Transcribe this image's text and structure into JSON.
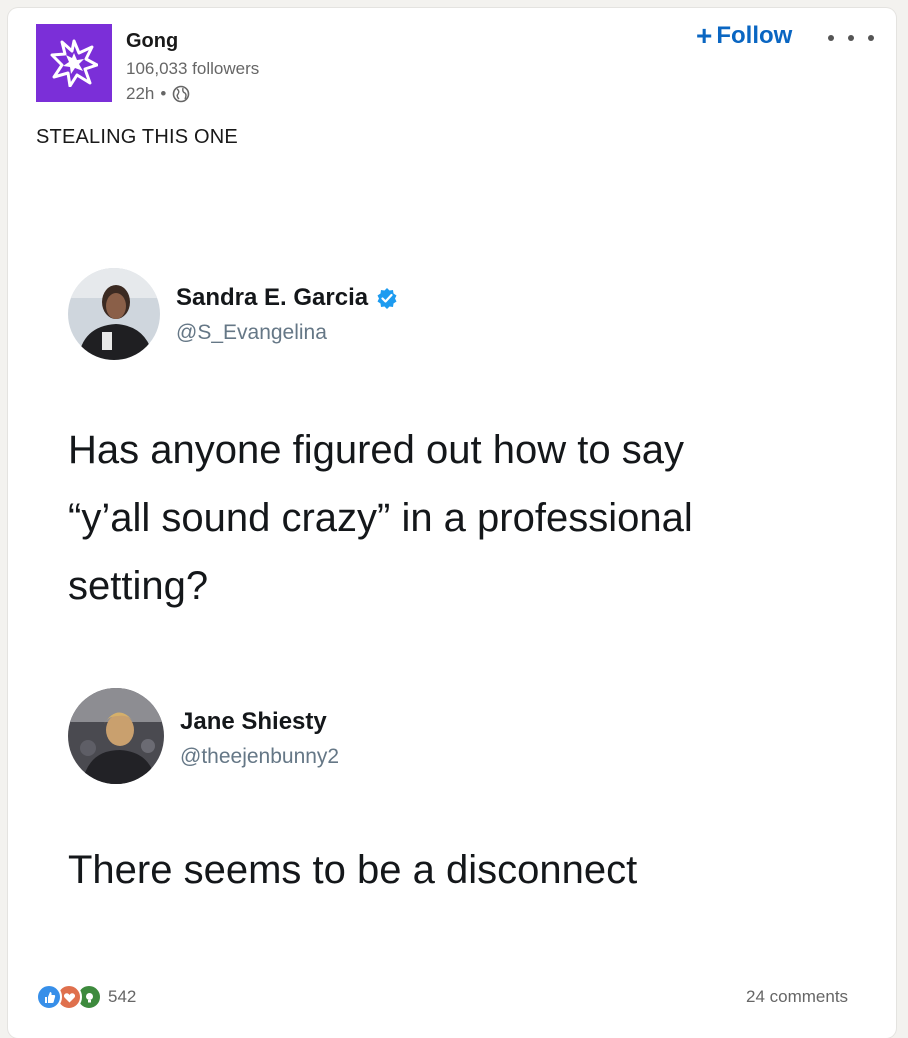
{
  "post": {
    "author": {
      "name": "Gong",
      "followers": "106,033 followers",
      "time": "22h",
      "separator": "•",
      "visibility_icon": "globe-icon",
      "logo_color": "#7b2fd8"
    },
    "follow_label": "Follow",
    "follow_plus": "+",
    "caption": "STEALING THIS ONE"
  },
  "tweets": [
    {
      "name": "Sandra E. Garcia",
      "handle": "@S_Evangelina",
      "verified": true,
      "lines": [
        "Has anyone figured out how to say",
        "“y’all sound crazy” in a professional",
        "setting?"
      ]
    },
    {
      "name": "Jane Shiesty",
      "handle": "@theejenbunny2",
      "verified": false,
      "lines": [
        "There seems to be a disconnect"
      ]
    }
  ],
  "social": {
    "reaction_icons": [
      "like-icon",
      "love-icon",
      "insightful-icon"
    ],
    "reaction_count": "542",
    "comments": "24 comments"
  },
  "colors": {
    "accent": "#0a66c2",
    "verified": "#1d9bf0"
  }
}
